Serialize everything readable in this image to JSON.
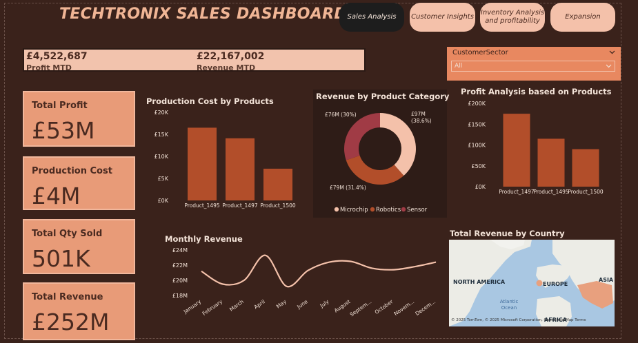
{
  "title": "TECHTRONIX SALES DASHBOARD",
  "nav": {
    "sales": "Sales Analysis",
    "customer": "Customer Insights",
    "inventory_l1": "Inventory Analysis",
    "inventory_l2": "and profitability",
    "expansion": "Expansion"
  },
  "mtd": {
    "profit_value": "£4,522,687",
    "profit_label": "Profit MTD",
    "revenue_value": "£22,167,002",
    "revenue_label": "Revenue MTD"
  },
  "slicer": {
    "header": "CustomerSector",
    "value": "All"
  },
  "kpis": [
    {
      "label": "Total Profit",
      "value": "£53M"
    },
    {
      "label": "Production Cost",
      "value": "£4M"
    },
    {
      "label": "Total Qty Sold",
      "value": "501K"
    },
    {
      "label": "Total Revenue",
      "value": "£252M"
    }
  ],
  "colors": {
    "bar": "#b24e2a",
    "line": "#f4c1aa",
    "background": "#3a221b",
    "card": "#e89b78"
  },
  "chart_data": [
    {
      "type": "bar",
      "title": "Production Cost by Products",
      "categories": [
        "Product_1495",
        "Product_1497",
        "Product_1500"
      ],
      "values": [
        16500,
        14100,
        7200
      ],
      "ylim": [
        0,
        20000
      ],
      "yticks": [
        "£0K",
        "£5K",
        "£10K",
        "£15K",
        "£20K"
      ]
    },
    {
      "type": "pie",
      "title": "Revenue by Product Category",
      "labels": [
        "Microchip",
        "Robotics",
        "Sensor"
      ],
      "values": [
        97,
        79,
        76
      ],
      "data_labels": [
        "£97M (38.6%)",
        "£79M (31.4%)",
        "£76M (30%)"
      ],
      "colors": [
        "#f4c1aa",
        "#b24e2a",
        "#a03b45"
      ],
      "legend": "bottom"
    },
    {
      "type": "bar",
      "title": "Profit Analysis based on Products",
      "categories": [
        "Product_1497",
        "Product_1495",
        "Product_1500"
      ],
      "values": [
        175000,
        115000,
        90000
      ],
      "ylim": [
        0,
        200000
      ],
      "yticks": [
        "£0K",
        "£50K",
        "£100K",
        "£150K",
        "£200K"
      ]
    },
    {
      "type": "line",
      "title": "Monthly Revenue",
      "x": [
        "January",
        "February",
        "March",
        "April",
        "May",
        "June",
        "July",
        "August",
        "Septem...",
        "October",
        "Novem...",
        "Decem..."
      ],
      "values": [
        21.2,
        19.5,
        20.0,
        23.3,
        19.2,
        21.3,
        22.4,
        22.5,
        21.6,
        21.4,
        21.8,
        22.4
      ],
      "ylim": [
        18,
        24
      ],
      "yticks": [
        "£18M",
        "£20M",
        "£22M",
        "£24M"
      ]
    }
  ],
  "map": {
    "title": "Total Revenue by Country",
    "labels": {
      "na": "NORTH AMERICA",
      "eu": "EUROPE",
      "as": "ASIA",
      "af": "AFRICA",
      "ocean": "Atlantic Ocean"
    },
    "attribution": "© 2025 TomTom, © 2025 Microsoft Corporation, OpenStreetMap Terms"
  }
}
